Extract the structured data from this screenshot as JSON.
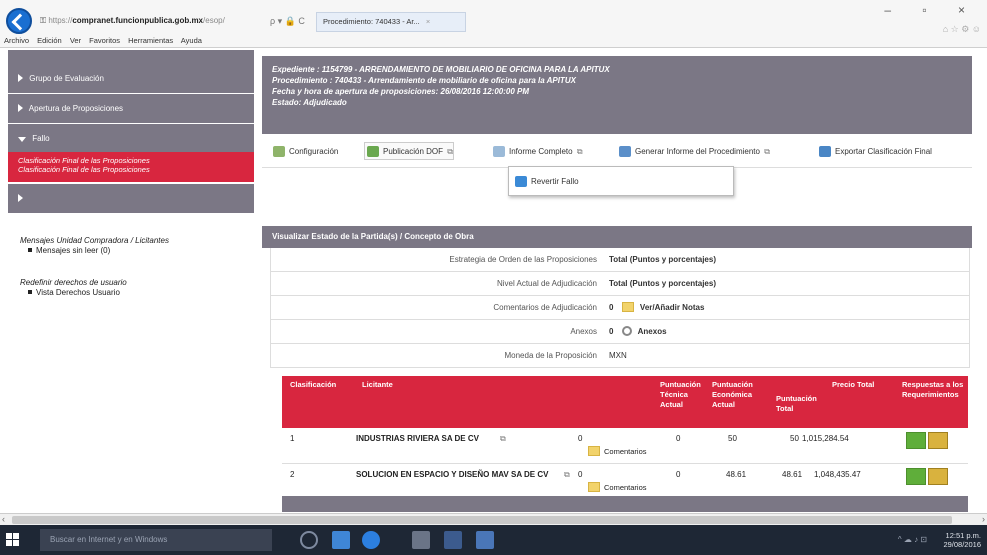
{
  "browser": {
    "address_prefix": "https://",
    "address_host": "compranet.funcionpublica.gob.mx",
    "address_suffix": "/esop/",
    "address_icons": "ρ ▾ 🔒 C",
    "tab_title": "Procedimiento: 740433 - Ar...",
    "tab_close": "×",
    "window_controls": "–  ▫  ×",
    "window_icons": "⌂ ☆ ⚙ ☺"
  },
  "menu": [
    "Archivo",
    "Edición",
    "Ver",
    "Favoritos",
    "Herramientas",
    "Ayuda"
  ],
  "sidebar": {
    "items": [
      {
        "label": "Grupo de Evaluación",
        "expanded": false
      },
      {
        "label": "Apertura de Proposiciones",
        "expanded": false
      },
      {
        "label": "Fallo",
        "expanded": true
      }
    ],
    "active": {
      "line1": "Clasificación Final de las Proposiciones",
      "line2": "Clasificación Final de las Proposiciones"
    },
    "mensajes_title": "Mensajes Unidad Compradora / Licitantes",
    "mensajes_item": "Mensajes sin leer (0)",
    "redefinir_title": "Redefinir derechos de usuario",
    "redefinir_item": "Vista Derechos Usuario"
  },
  "header": {
    "expediente": "Expediente : 1154799 - ARRENDAMIENTO DE MOBILIARIO DE OFICINA PARA LA APITUX",
    "procedimiento": "Procedimiento : 740433 - Arrendamiento de mobiliario de oficina para la APITUX",
    "fecha": "Fecha y hora de apertura de proposiciones: 26/08/2016 12:00:00 PM",
    "estado": "Estado: Adjudicado"
  },
  "actions": {
    "configuracion": "Configuración",
    "publicacion": "Publicación DOF",
    "informe": "Informe Completo",
    "generar": "Generar Informe del Procedimiento",
    "exportar": "Exportar Clasificación Final",
    "revertir": "Revertir Fallo",
    "ext_glyph": "⧉"
  },
  "detail": {
    "title": "Visualizar Estado de la Partida(s) / Concepto de Obra",
    "rows": [
      {
        "label": "Estrategia de Orden de las Proposiciones",
        "value": "Total (Puntos y porcentajes)"
      },
      {
        "label": "Nivel Actual de Adjudicación",
        "value": "Total (Puntos y porcentajes)"
      },
      {
        "label": "Comentarios de Adjudicación",
        "count": "0",
        "value": "Ver/Añadir Notas"
      },
      {
        "label": "Anexos",
        "count": "0",
        "value": "Anexos"
      },
      {
        "label": "Moneda de la Proposición",
        "value": "MXN"
      }
    ]
  },
  "table": {
    "headers": {
      "clasificacion": "Clasificación",
      "licitante": "Licitante",
      "puntuacion_tecnica": [
        "Puntuación",
        "Técnica",
        "Actual"
      ],
      "puntuacion_economica": [
        "Puntuación",
        "Económica",
        "Actual"
      ],
      "puntuacion_total": [
        "Puntuación",
        "Total"
      ],
      "precio_total": "Precio Total",
      "respuestas": [
        "Respuestas a los",
        "Requerimientos"
      ]
    },
    "rows": [
      {
        "rank": "1",
        "name": "INDUSTRIAS RIVIERA SA DE CV",
        "comments_count": "0",
        "comments_label": "Comentarios",
        "tecnica": "0",
        "economica": "50",
        "total": "50",
        "precio": "1,015,284.54"
      },
      {
        "rank": "2",
        "name": "SOLUCION EN ESPACIO Y DISEÑO MAV SA DE CV",
        "comments_count": "0",
        "comments_label": "Comentarios",
        "tecnica": "0",
        "economica": "48.61",
        "total": "48.61",
        "precio": "1,048,435.47"
      }
    ]
  },
  "taskbar": {
    "search_placeholder": "Buscar en Internet y en Windows",
    "time": "12:51 p.m.",
    "date": "29/08/2016",
    "tray_icons": "^ ☁ ♪ ⊡"
  },
  "colors": {
    "header_gray": "#7b7785",
    "accent_red": "#d8263f",
    "taskbar": "#1e2735"
  }
}
